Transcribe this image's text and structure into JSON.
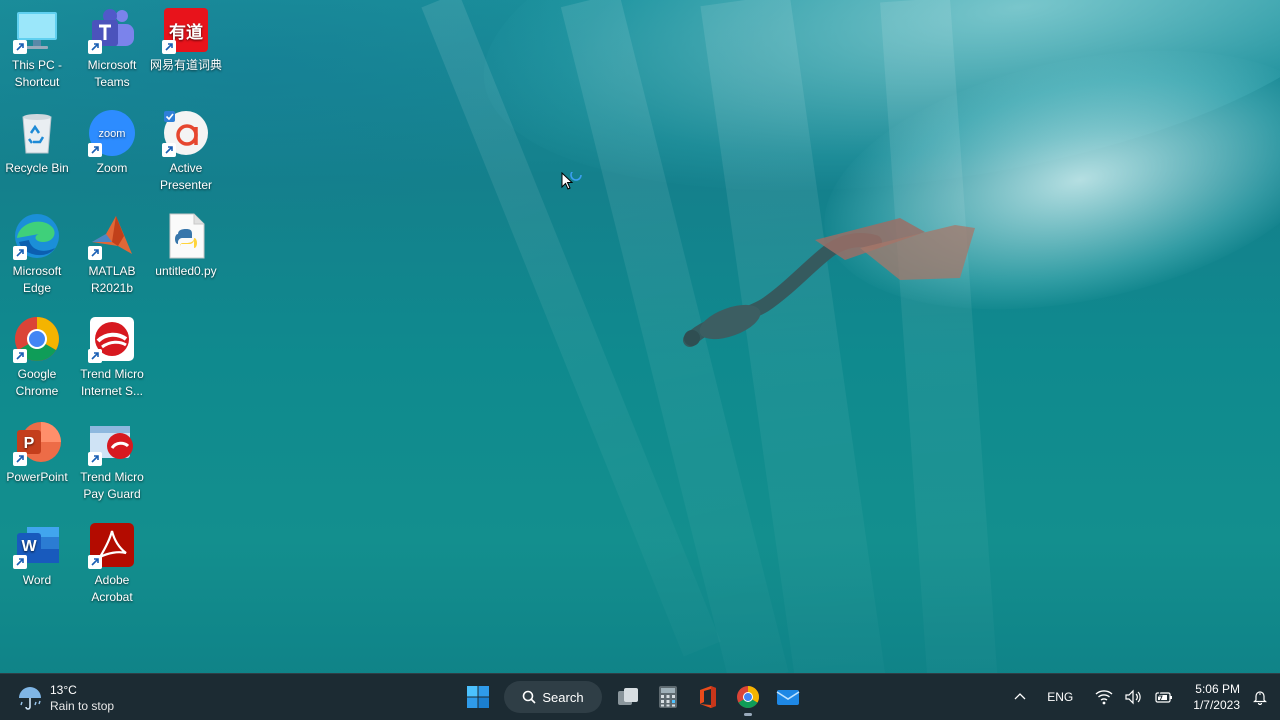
{
  "desktop": {
    "icons": [
      {
        "label": "This PC - Shortcut",
        "icon": "this-pc-icon"
      },
      {
        "label": "Microsoft Teams",
        "icon": "teams-icon"
      },
      {
        "label": "网易有道词典",
        "icon": "youdao-icon",
        "logo_text": "有道"
      },
      {
        "label": "Recycle Bin",
        "icon": "recycle-bin-icon"
      },
      {
        "label": "Zoom",
        "icon": "zoom-icon",
        "logo_text": "zoom"
      },
      {
        "label": "Active Presenter",
        "icon": "active-presenter-icon"
      },
      {
        "label": "Microsoft Edge",
        "icon": "edge-icon"
      },
      {
        "label": "MATLAB R2021b",
        "icon": "matlab-icon"
      },
      {
        "label": "untitled0.py",
        "icon": "python-file-icon"
      },
      {
        "label": "Google Chrome",
        "icon": "chrome-icon"
      },
      {
        "label": "Trend Micro Internet S...",
        "icon": "trend-micro-icon"
      },
      {
        "label": "PowerPoint",
        "icon": "powerpoint-icon",
        "logo_text": "P"
      },
      {
        "label": "Trend Micro Pay Guard",
        "icon": "pay-guard-icon"
      },
      {
        "label": "Word",
        "icon": "word-icon",
        "logo_text": "W"
      },
      {
        "label": "Adobe Acrobat",
        "icon": "acrobat-icon"
      }
    ]
  },
  "taskbar": {
    "weather": {
      "temp": "13°C",
      "condition": "Rain to stop",
      "icon": "rain-umbrella-icon"
    },
    "search_label": "Search",
    "pinned": [
      "start-icon",
      "search-icon",
      "task-view-icon",
      "calculator-icon",
      "office-icon",
      "chrome-icon",
      "mail-icon"
    ],
    "tray": {
      "language": "ENG",
      "time": "5:06 PM",
      "date": "1/7/2023"
    }
  },
  "colors": {
    "taskbar_bg": "#1c2b33",
    "wallpaper_teal": "#14808c",
    "win_blue": "#2f9bea"
  }
}
